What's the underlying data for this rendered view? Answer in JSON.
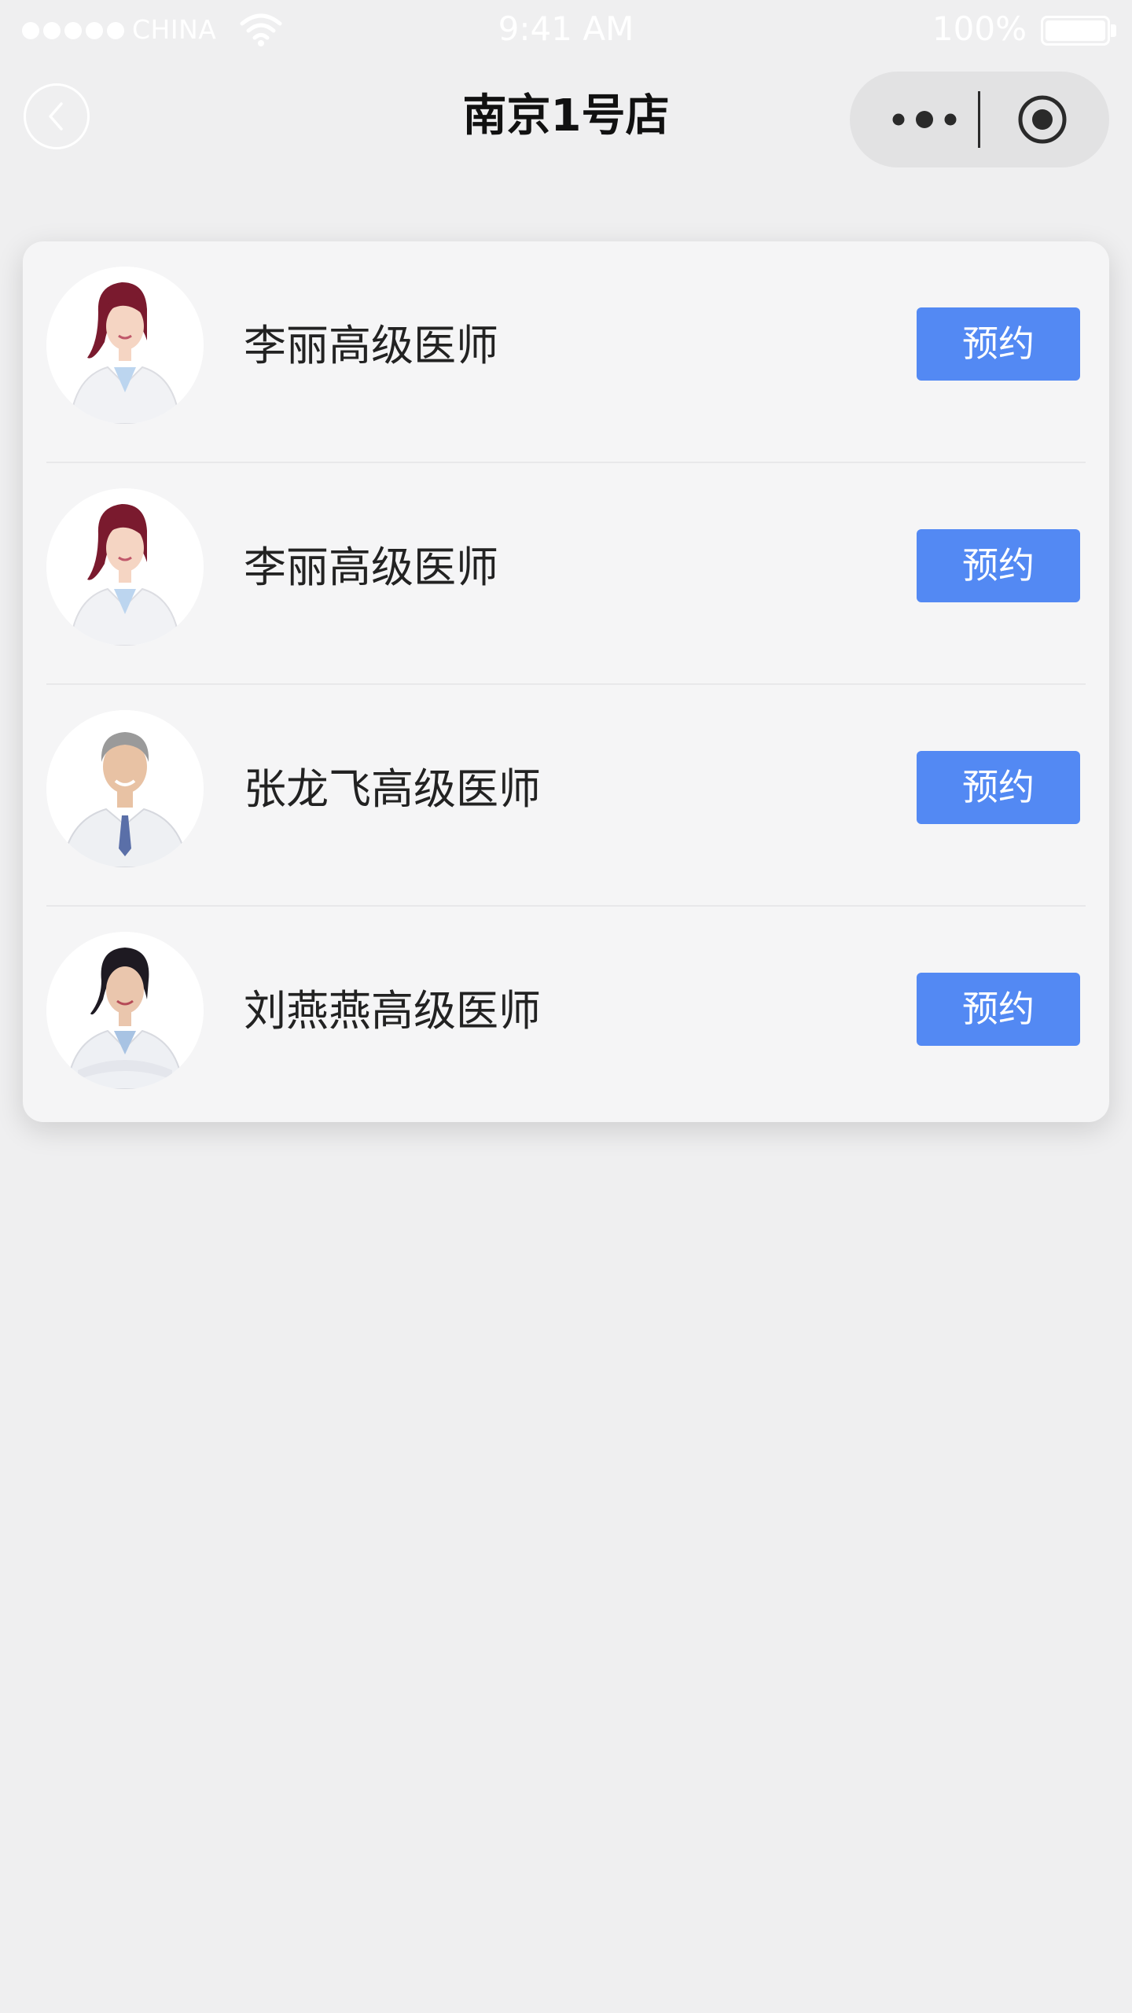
{
  "status_bar": {
    "carrier": "CHINA",
    "time": "9:41 AM",
    "battery": "100%"
  },
  "nav": {
    "title": "南京1号店"
  },
  "doctors": [
    {
      "name": "李丽高级医师",
      "button": "预约",
      "avatar": "female-doctor-avatar"
    },
    {
      "name": "李丽高级医师",
      "button": "预约",
      "avatar": "female-doctor-avatar"
    },
    {
      "name": "张龙飞高级医师",
      "button": "预约",
      "avatar": "male-doctor-avatar"
    },
    {
      "name": "刘燕燕高级医师",
      "button": "预约",
      "avatar": "female-doctor-avatar"
    }
  ],
  "colors": {
    "accent": "#5389f3",
    "background": "#efeff0",
    "card": "#f5f5f6"
  }
}
